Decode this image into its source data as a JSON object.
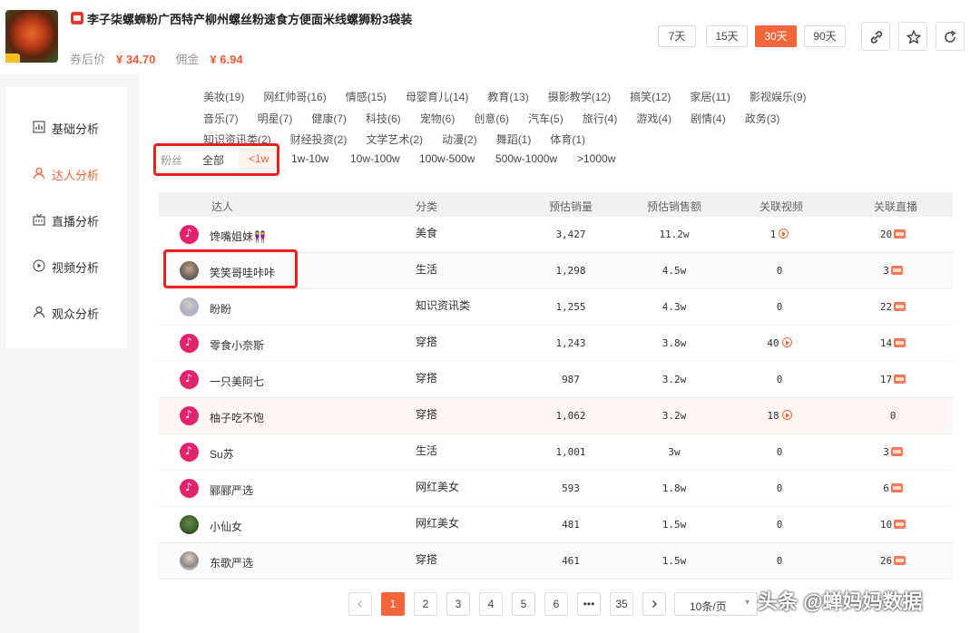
{
  "product": {
    "title": "李子柒螺蛳粉广西特产柳州螺丝粉速食方便面米线螺狮粉3袋装",
    "coupon_price_label": "券后价",
    "coupon_price": "¥ 34.70",
    "commission_label": "佣金",
    "commission": "¥ 6.94"
  },
  "day_filters": [
    "7天",
    "15天",
    "30天",
    "90天"
  ],
  "sidebar": {
    "items": [
      {
        "label": "基础分析",
        "icon": "bar-chart-icon"
      },
      {
        "label": "达人分析",
        "icon": "person-icon"
      },
      {
        "label": "直播分析",
        "icon": "tv-icon"
      },
      {
        "label": "视频分析",
        "icon": "play-circle-icon"
      },
      {
        "label": "观众分析",
        "icon": "person-icon"
      }
    ]
  },
  "categories": {
    "row1": [
      "美妆(19)",
      "网红帅哥(16)",
      "情感(15)",
      "母婴育儿(14)",
      "教育(13)",
      "摄影教学(12)",
      "搞笑(12)",
      "家居(11)",
      "影视娱乐(9)"
    ],
    "row2": [
      "音乐(7)",
      "明星(7)",
      "健康(7)",
      "科技(6)",
      "宠物(6)",
      "创意(6)",
      "汽车(5)",
      "旅行(4)",
      "游戏(4)",
      "剧情(4)",
      "政务(3)"
    ],
    "row3": [
      "知识资讯类(2)",
      "财经投资(2)",
      "文学艺术(2)",
      "动漫(2)",
      "舞蹈(1)",
      "体育(1)"
    ]
  },
  "fans_filter": {
    "label": "粉丝",
    "options": [
      "全部",
      "<1w",
      "1w-10w",
      "10w-100w",
      "100w-500w",
      "500w-1000w",
      ">1000w"
    ]
  },
  "table": {
    "headers": [
      "达人",
      "分类",
      "预估销量",
      "预估销售额",
      "关联视频",
      "关联直播"
    ],
    "rows": [
      {
        "name": "馋嘴姐妹👭",
        "category": "美食",
        "sales": "3,427",
        "revenue": "11.2w",
        "videos": "1",
        "lives": "20"
      },
      {
        "name": "笑笑哥哇咔咔",
        "category": "生活",
        "sales": "1,298",
        "revenue": "4.5w",
        "videos": "0",
        "lives": "3"
      },
      {
        "name": "盼盼",
        "category": "知识资讯类",
        "sales": "1,255",
        "revenue": "4.3w",
        "videos": "0",
        "lives": "22"
      },
      {
        "name": "零食小奈斯",
        "category": "穿搭",
        "sales": "1,243",
        "revenue": "3.8w",
        "videos": "40",
        "lives": "14"
      },
      {
        "name": "一只美阿七",
        "category": "穿搭",
        "sales": "987",
        "revenue": "3.2w",
        "videos": "0",
        "lives": "17"
      },
      {
        "name": "柚子吃不饱",
        "category": "穿搭",
        "sales": "1,062",
        "revenue": "3.2w",
        "videos": "18",
        "lives": "0"
      },
      {
        "name": "Su苏",
        "category": "生活",
        "sales": "1,001",
        "revenue": "3w",
        "videos": "0",
        "lives": "3"
      },
      {
        "name": "郦郦严选",
        "category": "网红美女",
        "sales": "593",
        "revenue": "1.8w",
        "videos": "0",
        "lives": "6"
      },
      {
        "name": "小仙女",
        "category": "网红美女",
        "sales": "481",
        "revenue": "1.5w",
        "videos": "0",
        "lives": "10"
      },
      {
        "name": "东歌严选",
        "category": "穿搭",
        "sales": "461",
        "revenue": "1.5w",
        "videos": "0",
        "lives": "26"
      }
    ]
  },
  "pagination": {
    "pages": [
      "1",
      "2",
      "3",
      "4",
      "5",
      "6",
      "•••",
      "35"
    ],
    "page_size": "10条/页"
  },
  "watermark": "头条 @蝉妈妈数据",
  "colors": {
    "accent": "#f4663b",
    "highlight_box": "#e8211c"
  }
}
